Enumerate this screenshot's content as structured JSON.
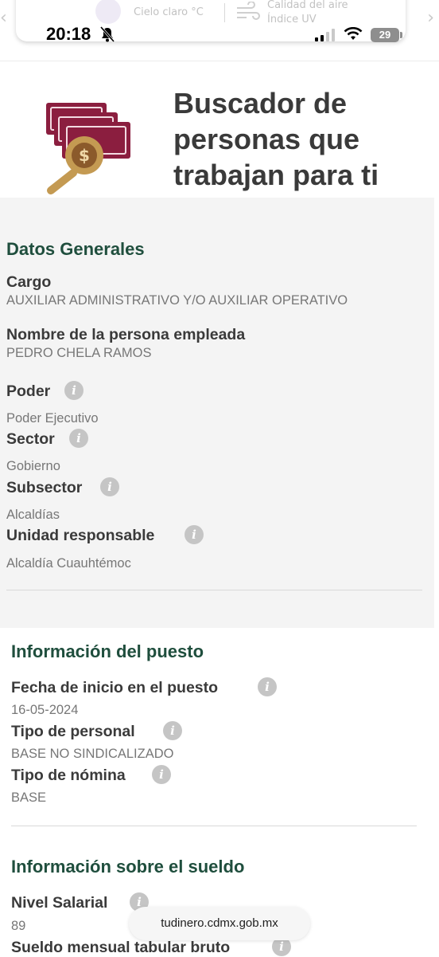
{
  "status_bar": {
    "time": "20:18",
    "battery": "29",
    "weather": "Cielo claro °C",
    "air_quality_line1": "Calidad del aire",
    "air_quality_line2": "Índice UV"
  },
  "header": {
    "title": "Buscador de personas que trabajan para ti"
  },
  "datos_generales": {
    "title": "Datos Generales",
    "cargo_label": "Cargo",
    "cargo_value": "AUXILIAR ADMINISTRATIVO Y/O AUXILIAR OPERATIVO",
    "nombre_label": "Nombre de la persona empleada",
    "nombre_value": "PEDRO CHELA RAMOS",
    "poder_label": "Poder",
    "poder_value": "Poder Ejecutivo",
    "sector_label": "Sector",
    "sector_value": "Gobierno",
    "subsector_label": "Subsector",
    "subsector_value": "Alcaldías",
    "unidad_label": "Unidad responsable",
    "unidad_value": "Alcaldía Cuauhtémoc"
  },
  "puesto": {
    "title": "Información del puesto",
    "fecha_label": "Fecha de inicio en el puesto",
    "fecha_value": "16-05-2024",
    "tipo_personal_label": "Tipo de personal",
    "tipo_personal_value": "BASE NO SINDICALIZADO",
    "tipo_nomina_label": "Tipo de nómina",
    "tipo_nomina_value": "BASE"
  },
  "sueldo": {
    "title": "Información sobre el sueldo",
    "nivel_label": "Nivel Salarial",
    "nivel_value": "89",
    "sueldo_label": "Sueldo mensual tabular bruto"
  },
  "browser": {
    "url": "tudinero.cdmx.gob.mx"
  },
  "icons": {
    "info": "info-icon",
    "moon": "moon-icon",
    "wind": "wind-icon",
    "bell": "bell-slash-icon",
    "signal": "signal-icon",
    "wifi": "wifi-icon",
    "logo": "money-search-icon"
  },
  "colors": {
    "section_title": "#1f4e3d",
    "logo_bills": "#8b1e3f",
    "logo_coin": "#c49a52",
    "gray_background": "#f4f4f4"
  }
}
